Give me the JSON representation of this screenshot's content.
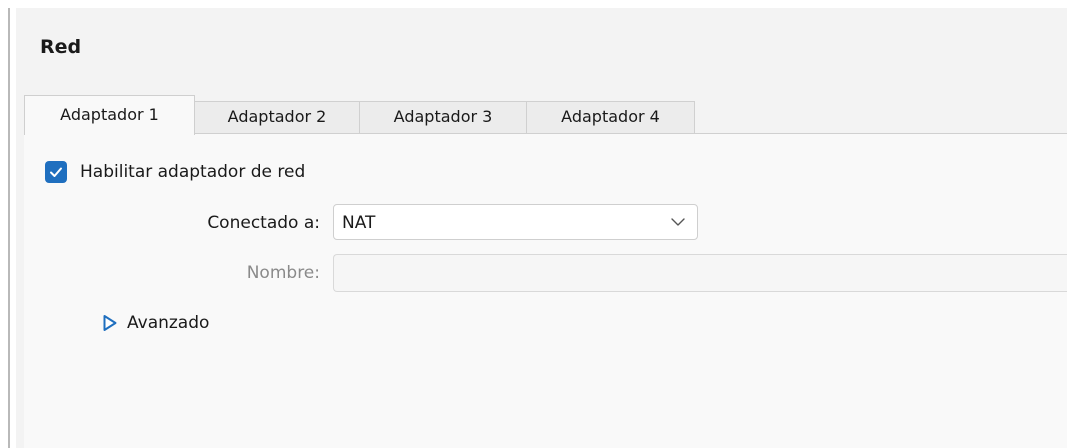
{
  "section": {
    "title": "Red"
  },
  "tabs": [
    {
      "label": "Adaptador 1",
      "active": true
    },
    {
      "label": "Adaptador 2",
      "active": false
    },
    {
      "label": "Adaptador 3",
      "active": false
    },
    {
      "label": "Adaptador 4",
      "active": false
    }
  ],
  "adapter": {
    "enable_label": "Habilitar adaptador de red",
    "enabled": true,
    "connected_label": "Conectado a:",
    "connected_value": "NAT",
    "name_label": "Nombre:",
    "name_value": "",
    "advanced_label": "Avanzado"
  },
  "colors": {
    "accent": "#1f6fbf",
    "panel": "#f3f3f3",
    "content": "#f9f9f9"
  },
  "icons": {
    "checkbox": "checkmark-icon",
    "dropdown": "chevron-down-icon",
    "expander": "triangle-right-icon"
  }
}
